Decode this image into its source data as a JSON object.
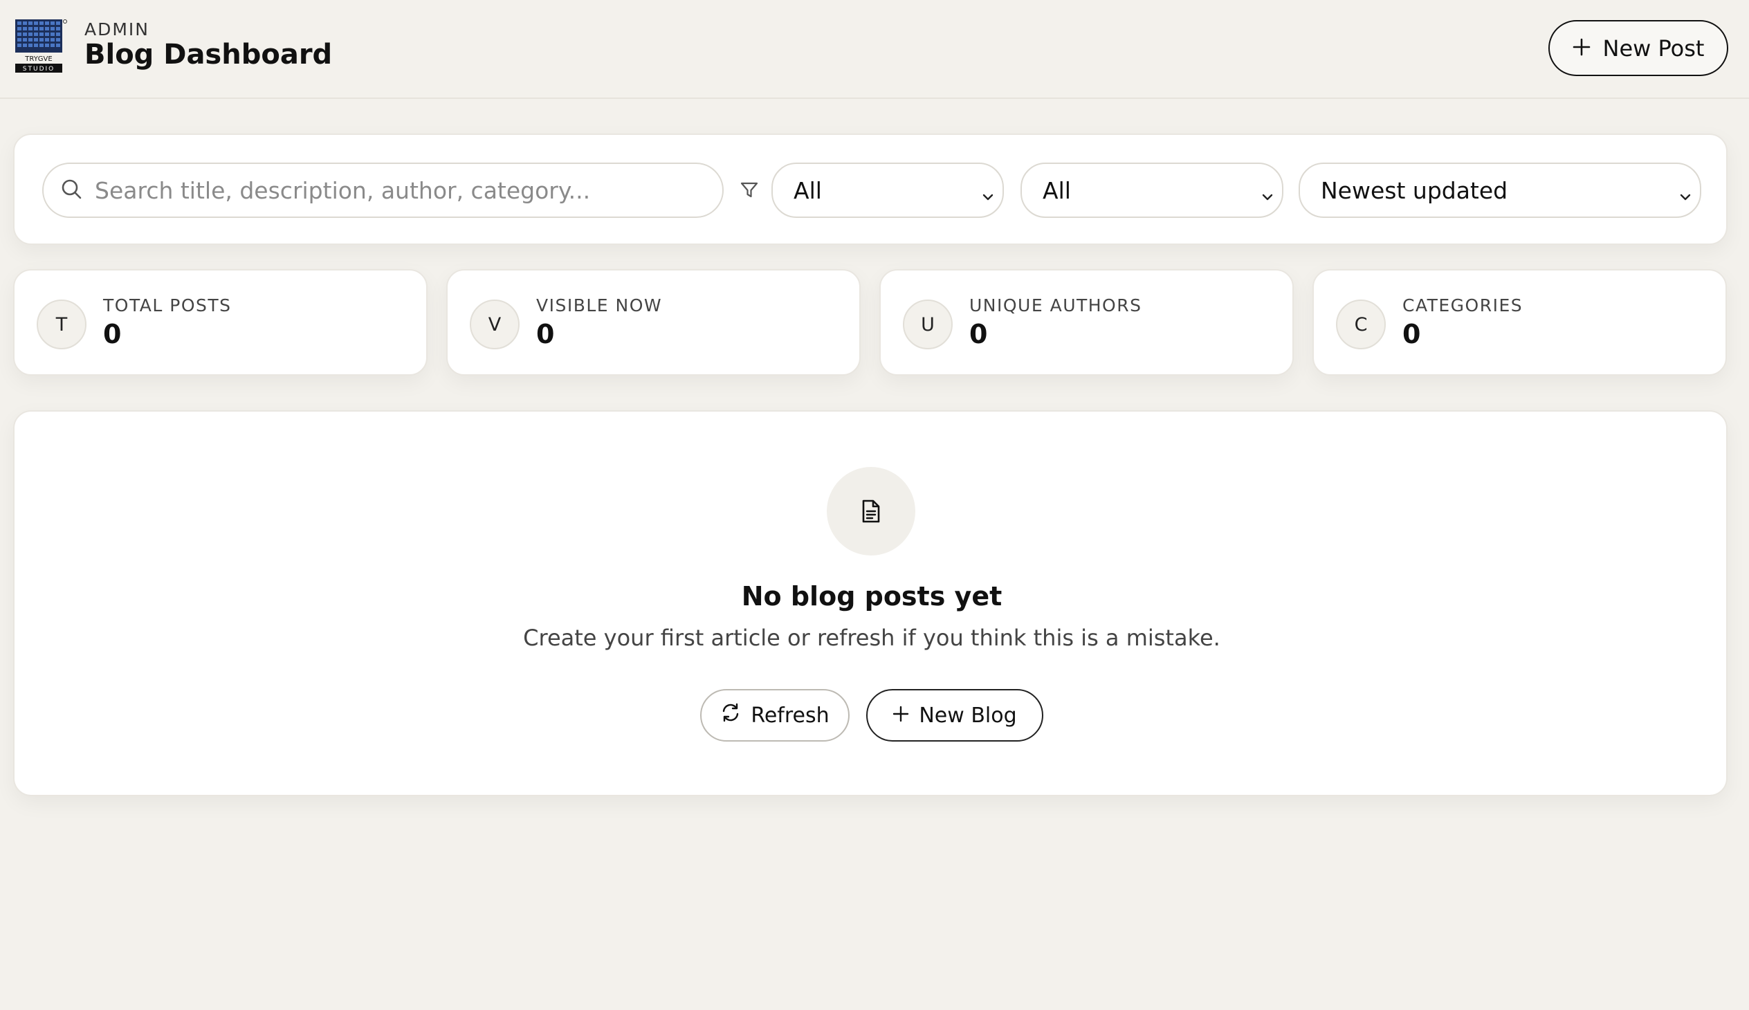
{
  "header": {
    "logo_text": "TRYGVE STUDIO",
    "section": "ADMIN",
    "title": "Blog Dashboard",
    "new_post_label": "New Post"
  },
  "filters": {
    "search_placeholder": "Search title, description, author, category...",
    "search_value": "",
    "visibility_value": "All",
    "category_value": "All",
    "sort_value": "Newest updated"
  },
  "stats": [
    {
      "initial": "T",
      "label": "TOTAL POSTS",
      "value": "0"
    },
    {
      "initial": "V",
      "label": "VISIBLE NOW",
      "value": "0"
    },
    {
      "initial": "U",
      "label": "UNIQUE AUTHORS",
      "value": "0"
    },
    {
      "initial": "C",
      "label": "CATEGORIES",
      "value": "0"
    }
  ],
  "empty_state": {
    "icon": "document-icon",
    "title": "No blog posts yet",
    "subtitle": "Create your first article or refresh if you think this is a mistake.",
    "refresh_label": "Refresh",
    "new_blog_label": "New Blog"
  },
  "colors": {
    "background": "#f3f1ec",
    "card": "#ffffff",
    "text": "#111111",
    "logo_blue": "#2f4f8f"
  }
}
